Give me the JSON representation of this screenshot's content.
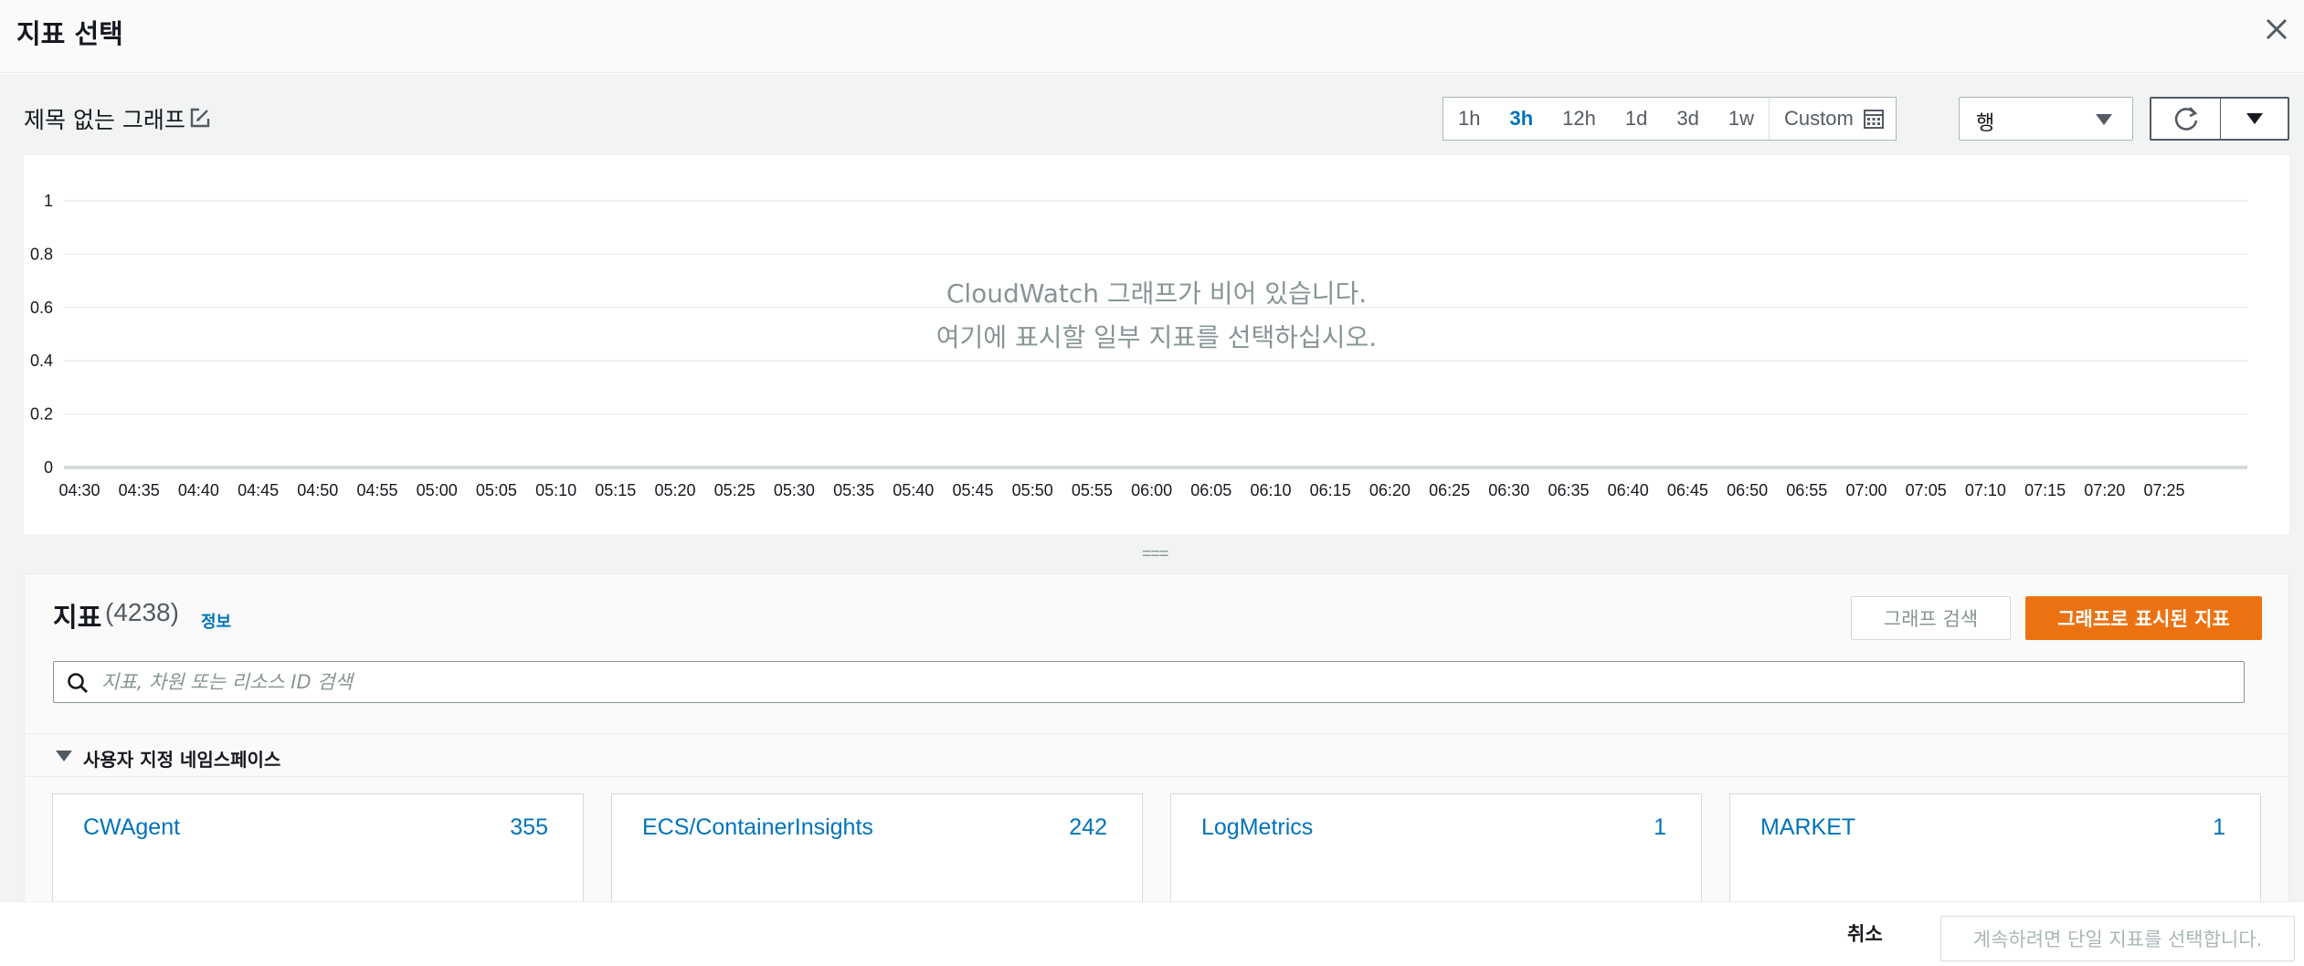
{
  "modal": {
    "title": "지표 선택"
  },
  "graph": {
    "title": "제목 없는 그래프",
    "empty_line1": "CloudWatch 그래프가 비어 있습니다.",
    "empty_line2": "여기에 표시할 일부 지표를 선택하십시오."
  },
  "time_range": {
    "options": [
      "1h",
      "3h",
      "12h",
      "1d",
      "3d",
      "1w"
    ],
    "active": "3h",
    "custom_label": "Custom"
  },
  "view_select": {
    "value": "행"
  },
  "chart_data": {
    "type": "line",
    "title": "",
    "xlabel": "",
    "ylabel": "",
    "ylim": [
      0,
      1
    ],
    "yticks": [
      "1",
      "0.8",
      "0.6",
      "0.4",
      "0.2",
      "0"
    ],
    "x": [
      "04:30",
      "04:35",
      "04:40",
      "04:45",
      "04:50",
      "04:55",
      "05:00",
      "05:05",
      "05:10",
      "05:15",
      "05:20",
      "05:25",
      "05:30",
      "05:35",
      "05:40",
      "05:45",
      "05:50",
      "05:55",
      "06:00",
      "06:05",
      "06:10",
      "06:15",
      "06:20",
      "06:25",
      "06:30",
      "06:35",
      "06:40",
      "06:45",
      "06:50",
      "06:55",
      "07:00",
      "07:05",
      "07:10",
      "07:15",
      "07:20",
      "07:25"
    ],
    "series": [],
    "grid": true
  },
  "splitter": {
    "glyph": "==="
  },
  "metrics": {
    "title": "지표",
    "count": "(4238)",
    "info_link": "정보",
    "graph_search_label": "그래프 검색",
    "graphed_metrics_label": "그래프로 표시된 지표",
    "search_placeholder": "지표, 차원 또는 리소스 ID 검색"
  },
  "namespaces": {
    "section_title": "사용자 지정 네임스페이스",
    "items": [
      {
        "name": "CWAgent",
        "count": "355"
      },
      {
        "name": "ECS/ContainerInsights",
        "count": "242"
      },
      {
        "name": "LogMetrics",
        "count": "1"
      },
      {
        "name": "MARKET",
        "count": "1"
      }
    ]
  },
  "footer": {
    "cancel_label": "취소",
    "confirm_label": "계속하려면 단일 지표를 선택합니다."
  },
  "colors": {
    "accent": "#0073bb",
    "primary_button": "#ec7211"
  },
  "icons": [
    "close-icon",
    "edit-icon",
    "calendar-icon",
    "refresh-icon",
    "chevron-down-icon",
    "search-icon",
    "caret-down-icon"
  ]
}
